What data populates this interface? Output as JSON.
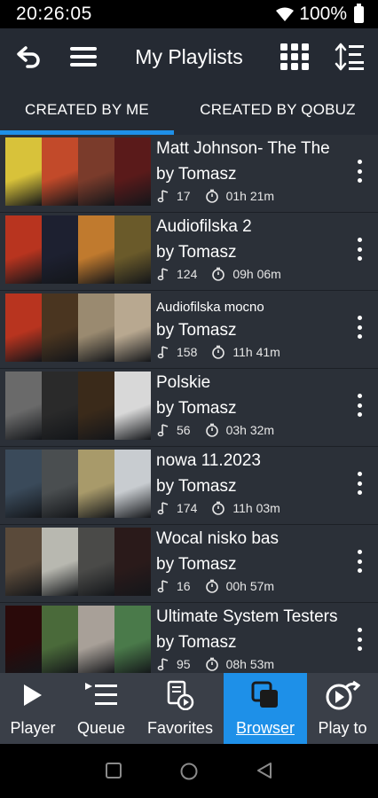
{
  "status": {
    "time": "20:26:05",
    "battery": "100%"
  },
  "header": {
    "title": "My Playlists"
  },
  "tabs": [
    {
      "label": "CREATED BY ME",
      "active": true
    },
    {
      "label": "CREATED BY QOBUZ",
      "active": false
    }
  ],
  "playlists": [
    {
      "title": "Matt Johnson- The The",
      "owner": "by Tomasz",
      "tracks": "17",
      "duration": "01h 21m",
      "covers": [
        "#d8c23a",
        "#c24a2a",
        "#7a3b2b",
        "#5a1a1a"
      ]
    },
    {
      "title": "Audiofilska 2",
      "owner": "by Tomasz",
      "tracks": "124",
      "duration": "09h 06m",
      "covers": [
        "#b8341f",
        "#1d2030",
        "#c07a2e",
        "#6a5a2a"
      ]
    },
    {
      "title": "Audiofilska mocno",
      "owner": "by Tomasz",
      "tracks": "158",
      "duration": "11h 41m",
      "covers": [
        "#b8341f",
        "#4a3520",
        "#9a8a70",
        "#b8a890"
      ]
    },
    {
      "title": "Polskie",
      "owner": "by Tomasz",
      "tracks": "56",
      "duration": "03h 32m",
      "covers": [
        "#6a6a6a",
        "#2a2a2a",
        "#3a2a1a",
        "#d8d8d8"
      ]
    },
    {
      "title": "nowa 11.2023",
      "owner": "by Tomasz",
      "tracks": "174",
      "duration": "11h 03m",
      "covers": [
        "#3a4a5a",
        "#4a4e50",
        "#a89a6a",
        "#c8ccd0"
      ]
    },
    {
      "title": "Wocal nisko bas",
      "owner": "by Tomasz",
      "tracks": "16",
      "duration": "00h 57m",
      "covers": [
        "#5a4a3a",
        "#b8b8b0",
        "#4a4a48",
        "#2a1a1a"
      ]
    },
    {
      "title": "Ultimate System Testers",
      "owner": "by Tomasz",
      "tracks": "95",
      "duration": "08h 53m",
      "covers": [
        "#2a0a0a",
        "#4a6a3a",
        "#a8a098",
        "#4a7a4a"
      ]
    }
  ],
  "bottom_nav": [
    {
      "label": "Player",
      "icon": "play-icon",
      "active": false
    },
    {
      "label": "Queue",
      "icon": "queue-icon",
      "active": false
    },
    {
      "label": "Favorites",
      "icon": "favorites-icon",
      "active": false
    },
    {
      "label": "Browser",
      "icon": "browser-icon",
      "active": true
    },
    {
      "label": "Play to",
      "icon": "play-to-icon",
      "active": false
    }
  ],
  "colors": {
    "accent": "#1e90e8",
    "header_bg": "#252a33",
    "list_bg": "#2b3038",
    "nav_bg": "#3a3f48"
  }
}
